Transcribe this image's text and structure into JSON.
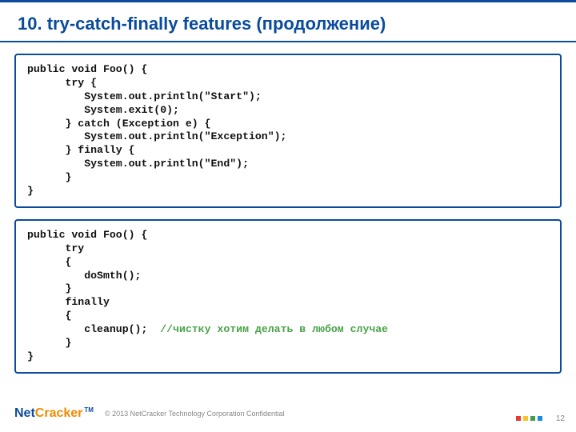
{
  "title": "10. try-catch-finally features (продолжение)",
  "code1": {
    "l1": "public void Foo() {",
    "l2": "      try {",
    "l3": "         System.out.println(\"Start\");",
    "l4": "         System.exit(0);",
    "l5": "      } catch (Exception e) {",
    "l6": "         System.out.println(\"Exception\");",
    "l7": "      } finally {",
    "l8": "         System.out.println(\"End\");",
    "l9": "      }",
    "l10": "}"
  },
  "code2": {
    "l1": "public void Foo() {",
    "l2": "      try",
    "l3": "      {",
    "l4": "         doSmth();",
    "l5": "      }",
    "l6": "      finally",
    "l7": "      {",
    "l8a": "         cleanup();  ",
    "l8b": "//чистку хотим делать в любом случае",
    "l9": "      }",
    "l10": "}"
  },
  "footer": {
    "logo_net": "Net",
    "logo_cracker": "Cracker",
    "logo_tm": "TM",
    "copyright": "© 2013 NetCracker Technology Corporation Confidential",
    "page": "12"
  }
}
